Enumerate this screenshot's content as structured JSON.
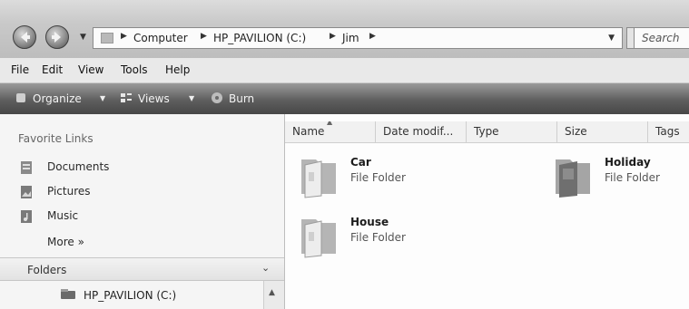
{
  "address_bar": {
    "breadcrumbs": [
      "Computer",
      "HP_PAVILION (C:)",
      "Jim"
    ],
    "search_placeholder": "Search"
  },
  "menu": {
    "items": [
      "File",
      "Edit",
      "View",
      "Tools",
      "Help"
    ]
  },
  "toolbar": {
    "organize": "Organize",
    "views": "Views",
    "burn": "Burn"
  },
  "nav_pane": {
    "favorites_header": "Favorite Links",
    "favorites": [
      {
        "label": "Documents",
        "icon": "documents-icon"
      },
      {
        "label": "Pictures",
        "icon": "pictures-icon"
      },
      {
        "label": "Music",
        "icon": "music-icon"
      }
    ],
    "more_label": "More »",
    "folders_header": "Folders",
    "tree_item": "HP_PAVILION (C:)"
  },
  "columns": [
    "Name",
    "Date modif...",
    "Type",
    "Size",
    "Tags"
  ],
  "files": [
    {
      "name": "Car",
      "type": "File Folder"
    },
    {
      "name": "Holiday",
      "type": "File Folder"
    },
    {
      "name": "House",
      "type": "File Folder"
    }
  ],
  "colors": {
    "toolbar_bg": "#5e5e5e",
    "content_bg": "#fdfdfd",
    "folder": "#c8c8c8"
  }
}
